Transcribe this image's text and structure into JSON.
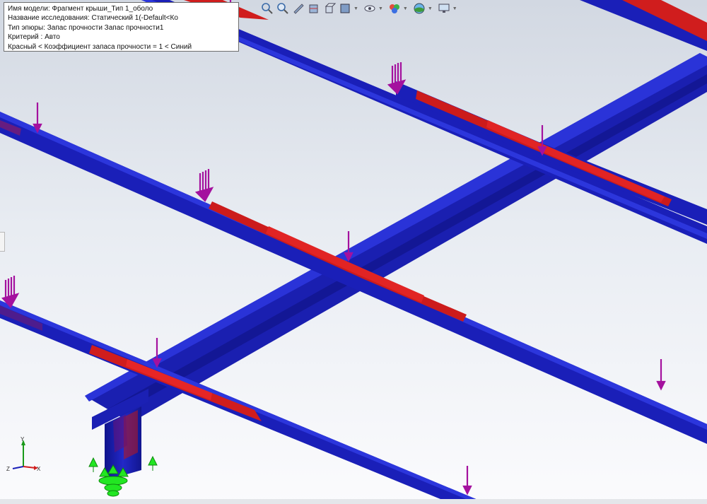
{
  "info": {
    "model_name": "Имя модели: Фрагмент крыши_Тип 1_оболо",
    "study_name": "Название исследования: Статический 1(-Default<Ко",
    "plot_type": "Тип эпюры: Запас прочности Запас прочности1",
    "criterion": "Критерий : Авто",
    "legend": "Красный < Коэффициент запаса прочности = 1 < Синий"
  },
  "colors": {
    "safe": "#1a1fb8",
    "unsafe": "#d41c1c",
    "load_arrow": "#a4119e",
    "fixture": "#22e622"
  },
  "toolbar": {
    "icons": [
      "zoom-to-fit-icon",
      "zoom-to-area-icon",
      "previous-view-icon",
      "section-view-icon",
      "view-orientation-icon",
      "display-style-icon",
      "hide-show-icon",
      "edit-appearance-icon",
      "apply-scene-icon",
      "view-settings-icon"
    ]
  },
  "triad": {
    "x": "X",
    "y": "Y",
    "z": "Z"
  }
}
